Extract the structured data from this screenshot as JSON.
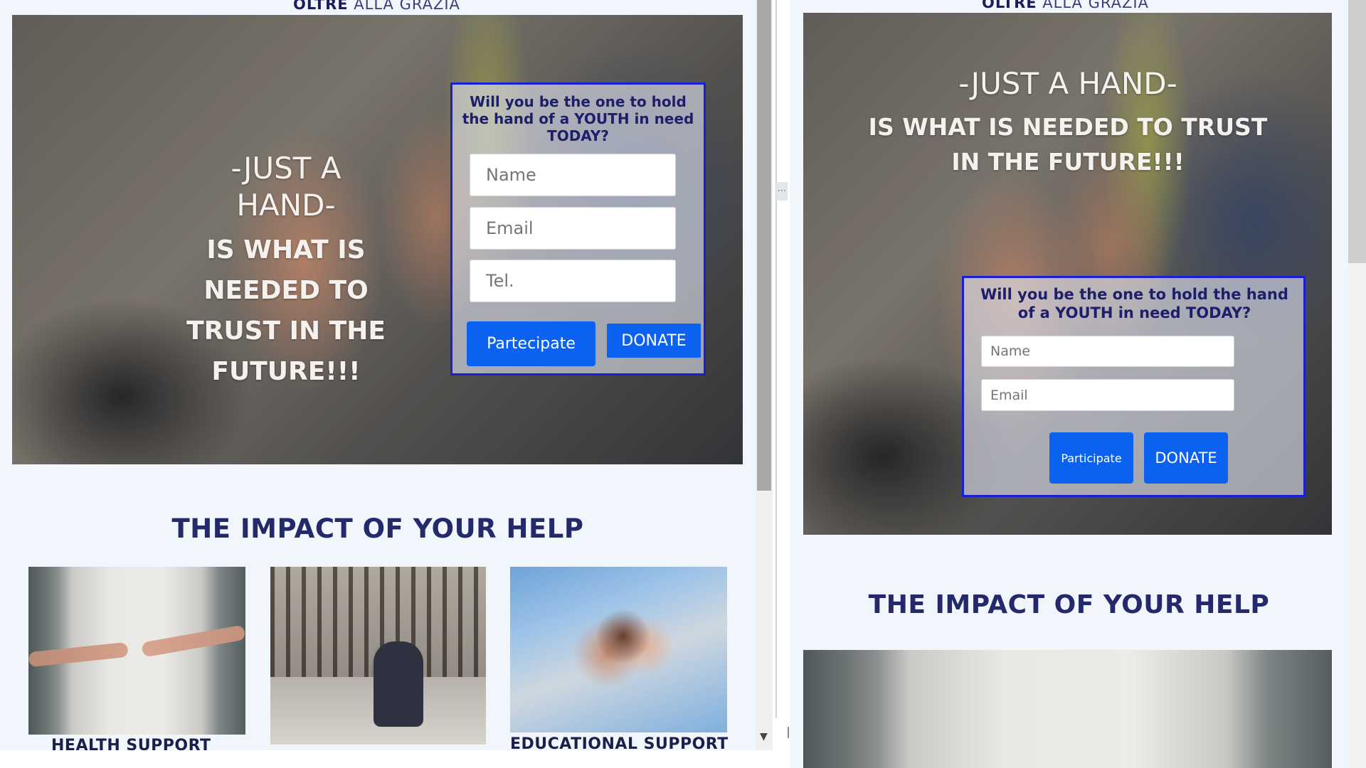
{
  "left": {
    "logo_bold": "OLTRE",
    "logo_light": "ALLA GRAZIA",
    "hero_line1": "-JUST A HAND-",
    "hero_line2": "IS WHAT IS NEEDED TO TRUST IN THE FUTURE!!!",
    "form_question": "Will you be the one to hold the hand of a YOUTH in need TODAY?",
    "name_placeholder": "Name",
    "email_placeholder": "Email",
    "tel_placeholder": "Tel.",
    "participate_label": "Partecipate",
    "donate_label": "DONATE",
    "impact_title": "THE IMPACT OF YOUR HELP",
    "cards": [
      {
        "label": "HEALTH SUPPORT"
      },
      {
        "label": ""
      },
      {
        "label": "EDUCATIONAL SUPPORT"
      }
    ]
  },
  "right": {
    "logo_bold": "OLTRE",
    "logo_light": "ALLA GRAZIA",
    "hero_line1": "-JUST A HAND-",
    "hero_line2": "IS WHAT IS NEEDED TO TRUST IN THE FUTURE!!!",
    "form_question": "Will you be the one to hold the hand of a YOUTH in need TODAY?",
    "name_placeholder": "Name",
    "email_placeholder": "Email",
    "participate_label": "Participate",
    "donate_label": "DONATE",
    "impact_title": "THE IMPACT OF YOUR HELP"
  },
  "colors": {
    "accent_blue": "#0b62f0",
    "form_border": "#1a1fd6",
    "heading_navy": "#23296b",
    "page_bg": "#f1f6fc"
  },
  "icons": {
    "scroll_down": "triangle-down-icon",
    "resize_handle": "drag-handle-icon"
  }
}
